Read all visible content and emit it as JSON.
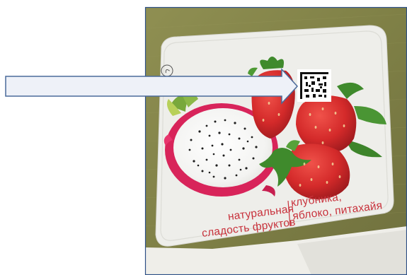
{
  "label": {
    "left_line1": "натуральная",
    "left_line2": "сладость фруктов",
    "right_line1": "клубника,",
    "right_line2": "яблоко, питахайя"
  },
  "colors": {
    "background_page": "#ffffff",
    "fabric": "#8a8a4a",
    "lid": "#eeeeea",
    "caption_red": "#c8323c",
    "arrow_fill": "#eef1f8",
    "arrow_stroke": "#4a6a9a"
  },
  "icons": {
    "qr": "qr-code-icon",
    "arrow": "arrow-right-icon"
  }
}
